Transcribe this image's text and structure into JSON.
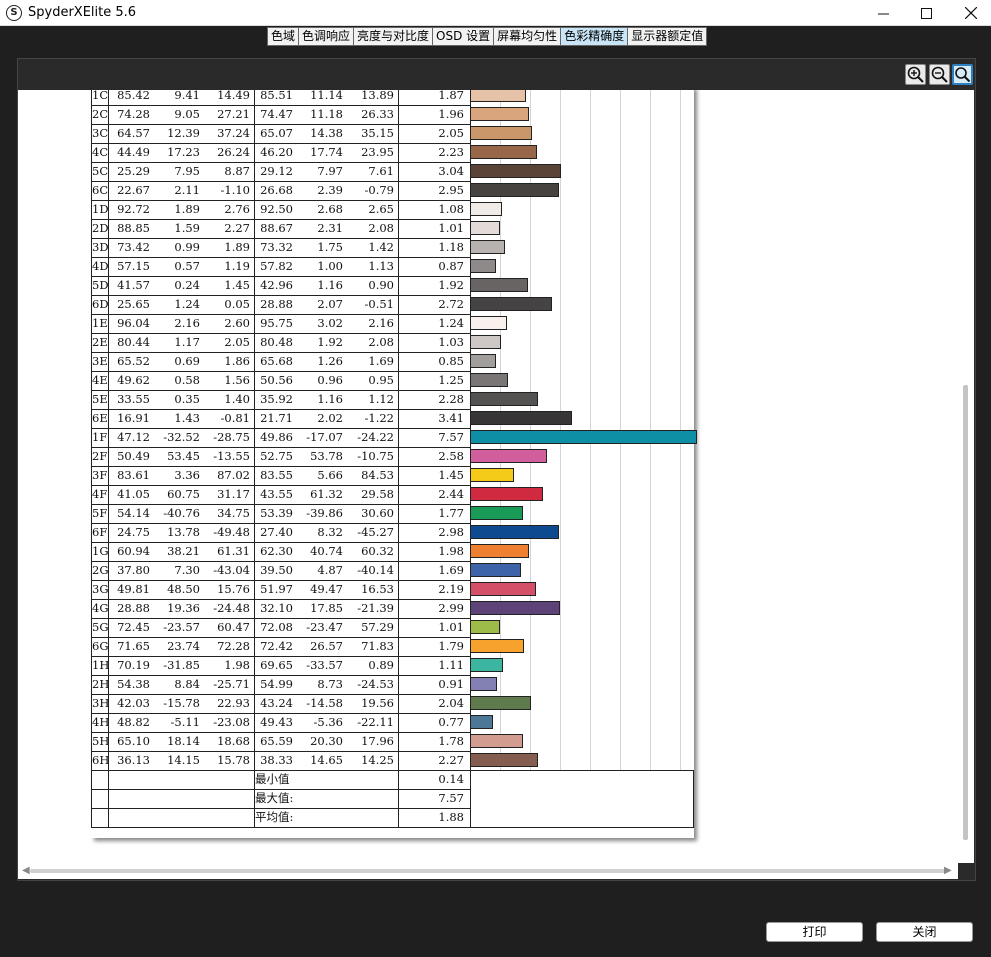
{
  "window": {
    "title": "SpyderXElite 5.6",
    "app_icon": "S"
  },
  "tabs": [
    "色域",
    "色调响应",
    "亮度与对比度",
    "OSD 设置",
    "屏幕均匀性",
    "色彩精确度",
    "显示器额定值"
  ],
  "active_tab": 5,
  "zoom_icons": [
    "zoom-in-icon",
    "zoom-out-icon",
    "zoom-fit-icon"
  ],
  "rows": [
    {
      "id": "1C",
      "a": [
        "85.42",
        "9.41",
        "14.49"
      ],
      "b": [
        "85.51",
        "11.14",
        "13.89"
      ],
      "de": "1.87",
      "color": "#e6c3a8"
    },
    {
      "id": "2C",
      "a": [
        "74.28",
        "9.05",
        "27.21"
      ],
      "b": [
        "74.47",
        "11.18",
        "26.33"
      ],
      "de": "1.96",
      "color": "#d9a57c"
    },
    {
      "id": "3C",
      "a": [
        "64.57",
        "12.39",
        "37.24"
      ],
      "b": [
        "65.07",
        "14.38",
        "35.15"
      ],
      "de": "2.05",
      "color": "#c9976a"
    },
    {
      "id": "4C",
      "a": [
        "44.49",
        "17.23",
        "26.24"
      ],
      "b": [
        "46.20",
        "17.74",
        "23.95"
      ],
      "de": "2.23",
      "color": "#986648"
    },
    {
      "id": "5C",
      "a": [
        "25.29",
        "7.95",
        "8.87"
      ],
      "b": [
        "29.12",
        "7.97",
        "7.61"
      ],
      "de": "3.04",
      "color": "#5a4437"
    },
    {
      "id": "6C",
      "a": [
        "22.67",
        "2.11",
        "-1.10"
      ],
      "b": [
        "26.68",
        "2.39",
        "-0.79"
      ],
      "de": "2.95",
      "color": "#454240"
    },
    {
      "id": "1D",
      "a": [
        "92.72",
        "1.89",
        "2.76"
      ],
      "b": [
        "92.50",
        "2.68",
        "2.65"
      ],
      "de": "1.08",
      "color": "#f1ebe7"
    },
    {
      "id": "2D",
      "a": [
        "88.85",
        "1.59",
        "2.27"
      ],
      "b": [
        "88.67",
        "2.31",
        "2.08"
      ],
      "de": "1.01",
      "color": "#e2dbd8"
    },
    {
      "id": "3D",
      "a": [
        "73.42",
        "0.99",
        "1.89"
      ],
      "b": [
        "73.32",
        "1.75",
        "1.42"
      ],
      "de": "1.18",
      "color": "#b7b1af"
    },
    {
      "id": "4D",
      "a": [
        "57.15",
        "0.57",
        "1.19"
      ],
      "b": [
        "57.82",
        "1.00",
        "1.13"
      ],
      "de": "0.87",
      "color": "#8d8a89"
    },
    {
      "id": "5D",
      "a": [
        "41.57",
        "0.24",
        "1.45"
      ],
      "b": [
        "42.96",
        "1.16",
        "0.90"
      ],
      "de": "1.92",
      "color": "#686463"
    },
    {
      "id": "6D",
      "a": [
        "25.65",
        "1.24",
        "0.05"
      ],
      "b": [
        "28.88",
        "2.07",
        "-0.51"
      ],
      "de": "2.72",
      "color": "#464344"
    },
    {
      "id": "1E",
      "a": [
        "96.04",
        "2.16",
        "2.60"
      ],
      "b": [
        "95.75",
        "3.02",
        "2.16"
      ],
      "de": "1.24",
      "color": "#f9f1ee"
    },
    {
      "id": "2E",
      "a": [
        "80.44",
        "1.17",
        "2.05"
      ],
      "b": [
        "80.48",
        "1.92",
        "2.08"
      ],
      "de": "1.03",
      "color": "#cdc7c5"
    },
    {
      "id": "3E",
      "a": [
        "65.52",
        "0.69",
        "1.86"
      ],
      "b": [
        "65.68",
        "1.26",
        "1.69"
      ],
      "de": "0.85",
      "color": "#a29e9c"
    },
    {
      "id": "4E",
      "a": [
        "49.62",
        "0.58",
        "1.56"
      ],
      "b": [
        "50.56",
        "0.96",
        "0.95"
      ],
      "de": "1.25",
      "color": "#797675"
    },
    {
      "id": "5E",
      "a": [
        "33.55",
        "0.35",
        "1.40"
      ],
      "b": [
        "35.92",
        "1.16",
        "1.12"
      ],
      "de": "2.28",
      "color": "#555252"
    },
    {
      "id": "6E",
      "a": [
        "16.91",
        "1.43",
        "-0.81"
      ],
      "b": [
        "21.71",
        "2.02",
        "-1.22"
      ],
      "de": "3.41",
      "color": "#383536"
    },
    {
      "id": "1F",
      "a": [
        "47.12",
        "-32.52",
        "-28.75"
      ],
      "b": [
        "49.86",
        "-17.07",
        "-24.22"
      ],
      "de": "7.57",
      "color": "#0f8fa6"
    },
    {
      "id": "2F",
      "a": [
        "50.49",
        "53.45",
        "-13.55"
      ],
      "b": [
        "52.75",
        "53.78",
        "-10.75"
      ],
      "de": "2.58",
      "color": "#d15e9d"
    },
    {
      "id": "3F",
      "a": [
        "83.61",
        "3.36",
        "87.02"
      ],
      "b": [
        "83.55",
        "5.66",
        "84.53"
      ],
      "de": "1.45",
      "color": "#f4cb19"
    },
    {
      "id": "4F",
      "a": [
        "41.05",
        "60.75",
        "31.17"
      ],
      "b": [
        "43.55",
        "61.32",
        "29.58"
      ],
      "de": "2.44",
      "color": "#cf2a40"
    },
    {
      "id": "5F",
      "a": [
        "54.14",
        "-40.76",
        "34.75"
      ],
      "b": [
        "53.39",
        "-39.86",
        "30.60"
      ],
      "de": "1.77",
      "color": "#1a9a57"
    },
    {
      "id": "6F",
      "a": [
        "24.75",
        "13.78",
        "-49.48"
      ],
      "b": [
        "27.40",
        "8.32",
        "-45.27"
      ],
      "de": "2.98",
      "color": "#0d4a8f"
    },
    {
      "id": "1G",
      "a": [
        "60.94",
        "38.21",
        "61.31"
      ],
      "b": [
        "62.30",
        "40.74",
        "60.32"
      ],
      "de": "1.98",
      "color": "#ef8032"
    },
    {
      "id": "2G",
      "a": [
        "37.80",
        "7.30",
        "-43.04"
      ],
      "b": [
        "39.50",
        "4.87",
        "-40.14"
      ],
      "de": "1.69",
      "color": "#3d64a9"
    },
    {
      "id": "3G",
      "a": [
        "49.81",
        "48.50",
        "15.76"
      ],
      "b": [
        "51.97",
        "49.47",
        "16.53"
      ],
      "de": "2.19",
      "color": "#d45068"
    },
    {
      "id": "4G",
      "a": [
        "28.88",
        "19.36",
        "-24.48"
      ],
      "b": [
        "32.10",
        "17.85",
        "-21.39"
      ],
      "de": "2.99",
      "color": "#5e4379"
    },
    {
      "id": "5G",
      "a": [
        "72.45",
        "-23.57",
        "60.47"
      ],
      "b": [
        "72.08",
        "-23.47",
        "57.29"
      ],
      "de": "1.01",
      "color": "#9dbb48"
    },
    {
      "id": "6G",
      "a": [
        "71.65",
        "23.74",
        "72.28"
      ],
      "b": [
        "72.42",
        "26.57",
        "71.83"
      ],
      "de": "1.79",
      "color": "#f7a22c"
    },
    {
      "id": "1H",
      "a": [
        "70.19",
        "-31.85",
        "1.98"
      ],
      "b": [
        "69.65",
        "-33.57",
        "0.89"
      ],
      "de": "1.11",
      "color": "#3cb6a1"
    },
    {
      "id": "2H",
      "a": [
        "54.38",
        "8.84",
        "-25.71"
      ],
      "b": [
        "54.99",
        "8.73",
        "-24.53"
      ],
      "de": "0.91",
      "color": "#8380b3"
    },
    {
      "id": "3H",
      "a": [
        "42.03",
        "-15.78",
        "22.93"
      ],
      "b": [
        "43.24",
        "-14.58",
        "19.56"
      ],
      "de": "2.04",
      "color": "#5f7a4d"
    },
    {
      "id": "4H",
      "a": [
        "48.82",
        "-5.11",
        "-23.08"
      ],
      "b": [
        "49.43",
        "-5.36",
        "-22.11"
      ],
      "de": "0.77",
      "color": "#4c7797"
    },
    {
      "id": "5H",
      "a": [
        "65.10",
        "18.14",
        "18.68"
      ],
      "b": [
        "65.59",
        "20.30",
        "17.96"
      ],
      "de": "1.78",
      "color": "#d29c91"
    },
    {
      "id": "6H",
      "a": [
        "36.13",
        "14.15",
        "15.78"
      ],
      "b": [
        "38.33",
        "14.65",
        "14.25"
      ],
      "de": "2.27",
      "color": "#855d4e"
    }
  ],
  "summary": [
    {
      "label": "最小值",
      "value": "0.14"
    },
    {
      "label": "最大值:",
      "value": "7.57"
    },
    {
      "label": "平均值:",
      "value": "1.88"
    }
  ],
  "buttons": {
    "print": "打印",
    "close": "关闭"
  }
}
